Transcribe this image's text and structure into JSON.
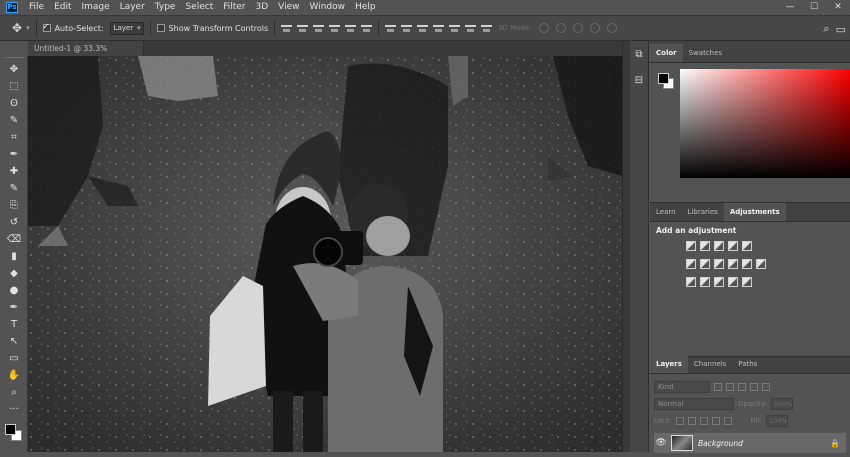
{
  "app": {
    "logo": "Ps"
  },
  "menu": [
    "File",
    "Edit",
    "Image",
    "Layer",
    "Type",
    "Select",
    "Filter",
    "3D",
    "View",
    "Window",
    "Help"
  ],
  "window_controls": {
    "minimize": "—",
    "maximize": "☐",
    "close": "✕"
  },
  "options": {
    "auto_select_label": "Auto-Select:",
    "auto_select_checked": true,
    "auto_select_value": "Layer",
    "transform_label": "Show Transform Controls",
    "mode_3d_label": "3D Mode:"
  },
  "document": {
    "tab_title": "Untitled-1 @ 33.3% (RGB/8)",
    "close": "×"
  },
  "tools": [
    "move-tool",
    "marquee-tool",
    "lasso-tool",
    "quick-select-tool",
    "crop-tool",
    "eyedropper-tool",
    "healing-tool",
    "brush-tool",
    "clone-stamp-tool",
    "history-brush-tool",
    "eraser-tool",
    "gradient-tool",
    "blur-tool",
    "dodge-tool",
    "pen-tool",
    "type-tool",
    "path-select-tool",
    "rectangle-tool",
    "hand-tool",
    "zoom-tool",
    "more-tools"
  ],
  "tool_glyphs": [
    "✥",
    "⬚",
    "ʘ",
    "✎",
    "⌗",
    "✒",
    "✚",
    "✎",
    "⎘",
    "↺",
    "⌫",
    "▮",
    "◆",
    "●",
    "✒",
    "T",
    "↖",
    "▭",
    "✋",
    "⌕",
    "···"
  ],
  "colors": {
    "foreground": "#000000",
    "background": "#ffffff",
    "accent": "#31a8ff"
  },
  "color_panel": {
    "tabs": [
      "Color",
      "Swatches"
    ],
    "active": 0
  },
  "adjust_panel": {
    "tabs": [
      "Learn",
      "Libraries",
      "Adjustments"
    ],
    "active": 2,
    "title": "Add an adjustment"
  },
  "layers_panel": {
    "tabs": [
      "Layers",
      "Channels",
      "Paths"
    ],
    "active": 0,
    "kind_placeholder": "Kind",
    "blend_mode": "Normal",
    "opacity_label": "Opacity:",
    "opacity_value": "100%",
    "lock_label": "Lock:",
    "fill_label": "Fill:",
    "fill_value": "100%",
    "layers": [
      {
        "name": "Background",
        "visible": true,
        "locked": true
      }
    ]
  }
}
